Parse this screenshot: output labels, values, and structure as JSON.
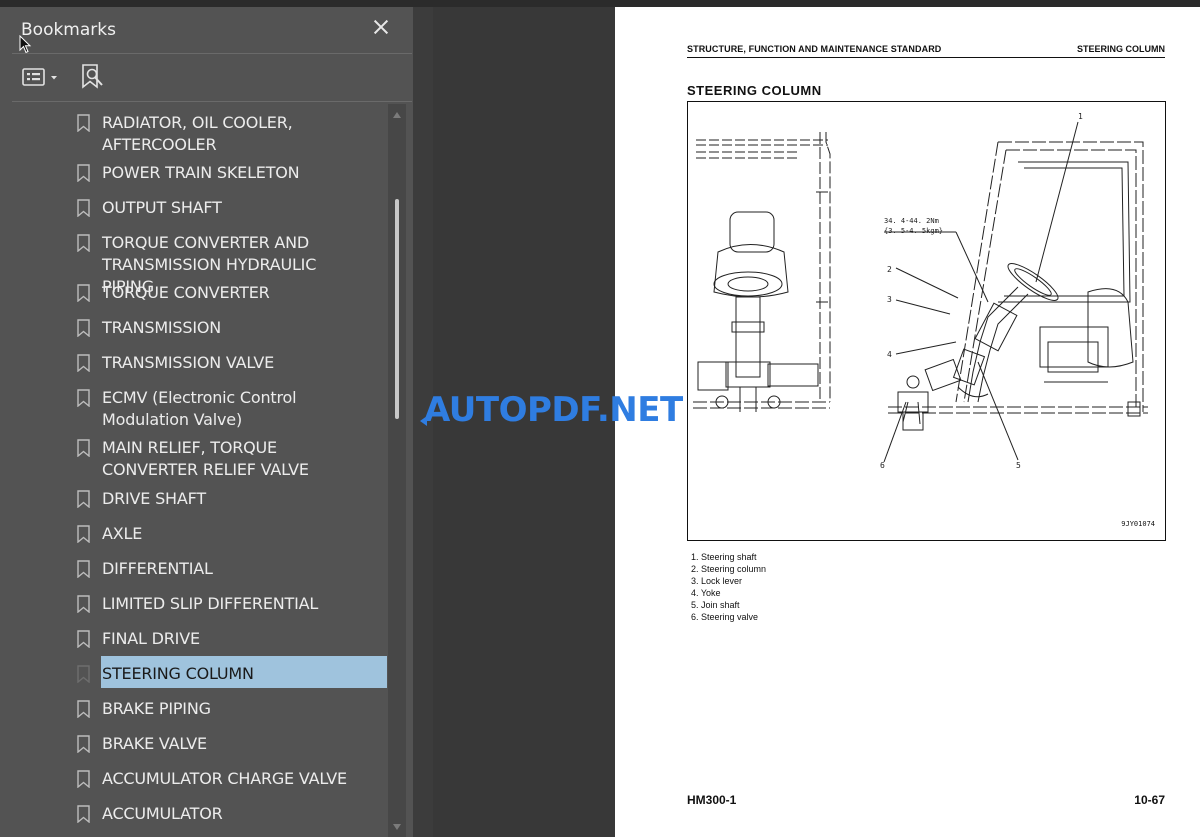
{
  "bookmarks_panel": {
    "title": "Bookmarks",
    "close_icon": "close-icon",
    "options_icon": "options-menu-icon",
    "find_icon": "find-bookmark-icon",
    "items": [
      {
        "label": "RADIATOR, OIL COOLER, AFTERCOOLER"
      },
      {
        "label": "POWER TRAIN SKELETON"
      },
      {
        "label": "OUTPUT SHAFT"
      },
      {
        "label": "TORQUE CONVERTER AND TRANSMISSION HYDRAULIC PIPING"
      },
      {
        "label": "TORQUE CONVERTER"
      },
      {
        "label": "TRANSMISSION"
      },
      {
        "label": "TRANSMISSION VALVE"
      },
      {
        "label": "ECMV (Electronic Control Modulation Valve)"
      },
      {
        "label": "MAIN RELIEF, TORQUE CONVERTER RELIEF VALVE"
      },
      {
        "label": "DRIVE SHAFT"
      },
      {
        "label": "AXLE"
      },
      {
        "label": "DIFFERENTIAL"
      },
      {
        "label": "LIMITED SLIP DIFFERENTIAL"
      },
      {
        "label": "FINAL DRIVE"
      },
      {
        "label": "STEERING COLUMN",
        "selected": true
      },
      {
        "label": "BRAKE PIPING"
      },
      {
        "label": "BRAKE VALVE"
      },
      {
        "label": "ACCUMULATOR CHARGE VALVE"
      },
      {
        "label": "ACCUMULATOR"
      }
    ]
  },
  "document_page": {
    "header_left": "STRUCTURE, FUNCTION AND MAINTENANCE STANDARD",
    "header_right": "STEERING COLUMN",
    "section_title": "STEERING COLUMN",
    "figure": {
      "torque_line1": "34. 4-44. 2Nm",
      "torque_line2": "{3. 5-4. 5kgm}",
      "callouts": [
        "1",
        "2",
        "3",
        "4",
        "5",
        "6"
      ],
      "figure_code": "9JY01074"
    },
    "legend": [
      "1. Steering shaft",
      "2. Steering column",
      "3. Lock lever",
      "4. Yoke",
      "5. Join shaft",
      "6. Steering valve"
    ],
    "footer_left": "HM300-1",
    "footer_right": "10-67"
  },
  "watermark": "AUTOPDF.NET",
  "colors": {
    "panel_bg": "#535353",
    "selection": "#9fc3dd",
    "watermark": "#2f7de1"
  }
}
